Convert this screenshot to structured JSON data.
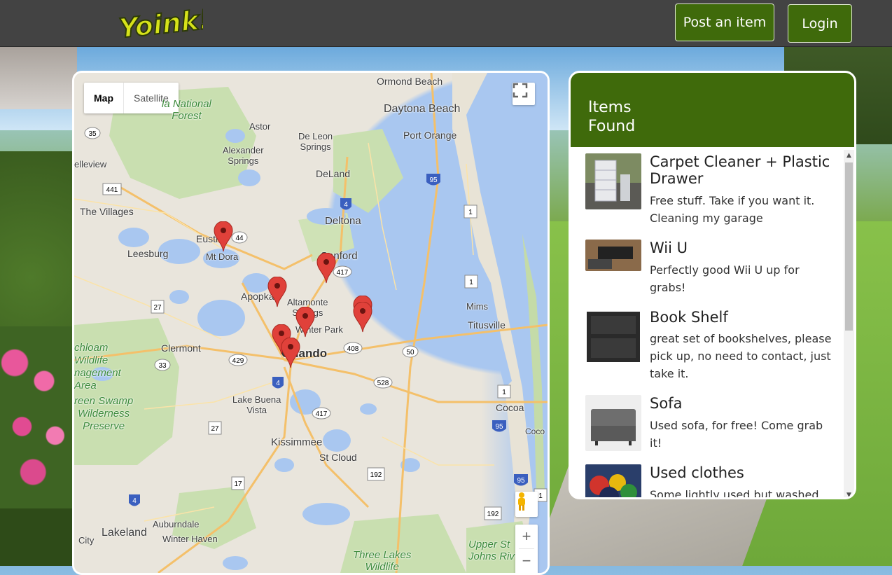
{
  "header": {
    "logo_text": "Yoink!",
    "post_label": "Post an item",
    "login_label": "Login"
  },
  "map": {
    "type_map": "Map",
    "type_satellite": "Satellite",
    "zoom_in": "+",
    "zoom_out": "−",
    "labels": {
      "ormond_beach": "Ormond Beach",
      "daytona_beach": "Daytona Beach",
      "port_orange": "Port Orange",
      "ocala_forest": "la National\nForest",
      "astor": "Astor",
      "de_leon": "De Leon\nSprings",
      "alexander": "Alexander\nSprings",
      "deland": "DeLand",
      "leview": "elleview",
      "villages": "The Villages",
      "deltona": "Deltona",
      "eustis": "Eustis",
      "mt_dora": "Mt Dora",
      "leesburg": "Leesburg",
      "sanford": "Sanford",
      "apopka": "Apopka",
      "altamonte": "Altamonte\nSprings",
      "mims": "Mims",
      "winter_park": "Winter Park",
      "titusville": "Titusville",
      "clermont": "Clermont",
      "orlando": "Orlando",
      "chloam": "chloam\nWildlife\nnagement\nArea",
      "green_swamp": "reen Swamp\nWilderness\nPreserve",
      "lake_buena": "Lake Buena\nVista",
      "cocoa": "Cocoa",
      "coco": "Coco",
      "kissimmee": "Kissimmee",
      "st_cloud": "St Cloud",
      "auburndale": "Auburndale",
      "winter_haven": "Winter Haven",
      "lakeland": "Lakeland",
      "city": "City",
      "three_lakes": "Three Lakes\nWildlife",
      "upper_st_johns": "Upper St\nJohns Riv"
    },
    "shields": [
      "35",
      "441",
      "95",
      "4",
      "1",
      "44",
      "417",
      "27",
      "1",
      "408",
      "50",
      "429",
      "33",
      "4",
      "528",
      "1",
      "27",
      "417",
      "95",
      "192",
      "17",
      "4",
      "192",
      "95",
      "1"
    ]
  },
  "items": {
    "title": "Items Found",
    "list": [
      {
        "title": "Carpet Cleaner + Plastic Drawer",
        "desc": "Free stuff. Take if you want it. Cleaning my garage",
        "image": "carpet-cleaner-drawer-photo"
      },
      {
        "title": "Wii U",
        "desc": "Perfectly good Wii U up for grabs!",
        "image": "wii-u-photo"
      },
      {
        "title": "Book Shelf",
        "desc": "great set of bookshelves, please pick up, no need to contact, just take it.",
        "image": "book-shelf-photo"
      },
      {
        "title": "Sofa",
        "desc": "Used sofa, for free! Come grab it!",
        "image": "sofa-photo"
      },
      {
        "title": "Used clothes",
        "desc": "Some lightly used but washed",
        "image": "used-clothes-photo"
      }
    ]
  },
  "colors": {
    "accent_green": "#3f6a0b",
    "header_bg": "#434343",
    "pin_red": "#e0413a"
  }
}
